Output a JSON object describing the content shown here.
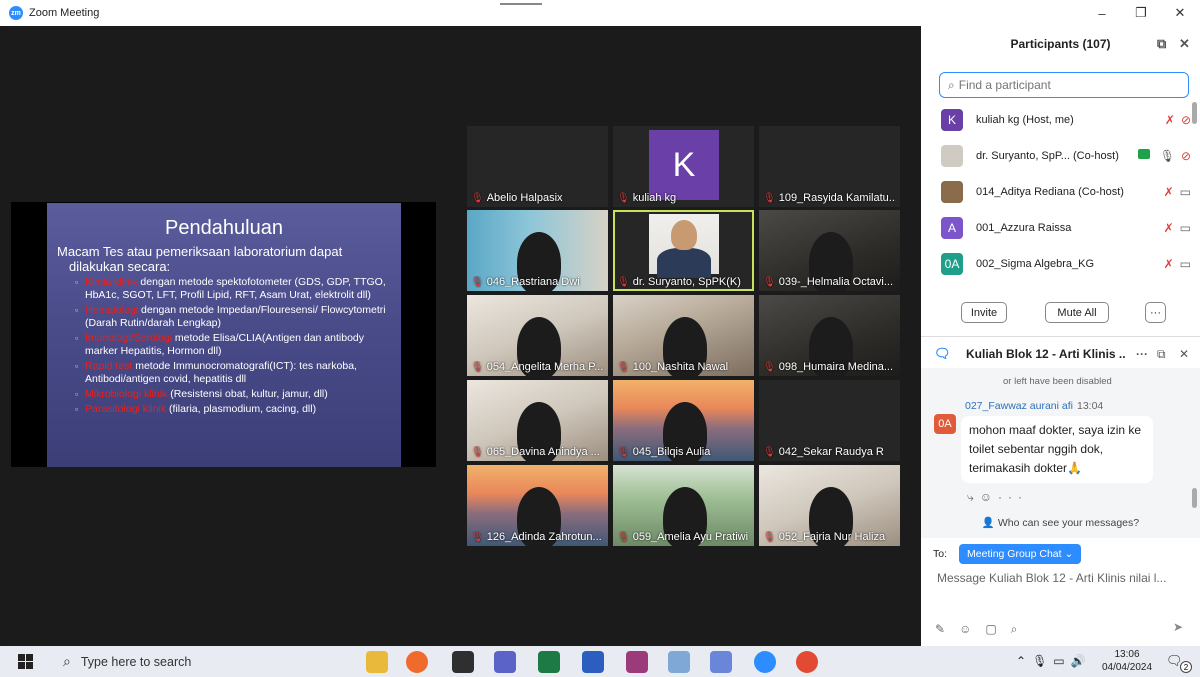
{
  "window": {
    "title": "Zoom Meeting",
    "minimize": "–",
    "restore": "❐",
    "close": "✕"
  },
  "slide": {
    "title": "Pendahuluan",
    "lead1": "Macam Tes atau pemeriksaan laboratorium dapat",
    "lead2": "dilakukan secara:",
    "items": [
      {
        "key": "Kimia klinik",
        "text": " dengan metode spektofotometer (GDS, GDP, TTGO, HbA1c,   SGOT, LFT, Profil Lipid, RFT, Asam Urat, elektrolit dll)"
      },
      {
        "key": "Hematologi",
        "text": " dengan metode Impedan/Flouresensi/ Flowcytometri (Darah Rutin/darah Lengkap)"
      },
      {
        "key": "Imunologi/Serologi",
        "text": " metode Elisa/CLIA(Antigen dan antibody marker Hepatitis, Hormon dll)"
      },
      {
        "key": "Rapid test",
        "text": " metode Immunocromatografi(ICT): tes narkoba, Antibodi/antigen covid, hepatitis dll"
      },
      {
        "key": "Mikrobiologi klinik",
        "text": " (Resistensi obat, kultur, jamur, dll)"
      },
      {
        "key": "Parasitologi klinik",
        "text": " (filaria, plasmodium, cacing, dll)"
      }
    ]
  },
  "gallery": [
    {
      "name": "Abelio Halpasix",
      "bg": "none"
    },
    {
      "name": "kuliah kg",
      "bg": "avatar",
      "initial": "K"
    },
    {
      "name": "109_Rasyida Kamilatu...",
      "bg": "none"
    },
    {
      "name": "046_Rastriana Dwi",
      "bg": "window"
    },
    {
      "name": "dr. Suryanto, SpPK(K)",
      "bg": "speaker",
      "active": true
    },
    {
      "name": "039-_Helmalia Octavi...",
      "bg": "dark"
    },
    {
      "name": "054_Angelita Merha P...",
      "bg": "light"
    },
    {
      "name": "100_Nashita Nawal",
      "bg": "room"
    },
    {
      "name": "098_Humaira Medina...",
      "bg": "dark"
    },
    {
      "name": "065_Davina Anindya ...",
      "bg": "light"
    },
    {
      "name": "045_Bilqis Aulia",
      "bg": "bridge"
    },
    {
      "name": "042_Sekar Raudya R",
      "bg": "none"
    },
    {
      "name": "126_Adinda Zahrotun...",
      "bg": "bridge"
    },
    {
      "name": "059_Amelia Ayu Pratiwi",
      "bg": "palm"
    },
    {
      "name": "052_Fajria Nur Haliza",
      "bg": "light"
    }
  ],
  "participants": {
    "header": "Participants (107)",
    "search_placeholder": "Find a participant",
    "list": [
      {
        "initial": "K",
        "color": "#6b3fa8",
        "name": "kuliah kg (Host, me)"
      },
      {
        "initial": "",
        "color": "#cfcac2",
        "name": "dr. Suryanto, SpP... (Co-host)"
      },
      {
        "initial": "",
        "color": "#8a6b4a",
        "name": "014_Aditya Rediana (Co-host)"
      },
      {
        "initial": "A",
        "color": "#7b55c9",
        "name": "001_Azzura Raissa"
      },
      {
        "initial": "0A",
        "color": "#1f9e8a",
        "name": "002_Sigma Algebra_KG"
      }
    ],
    "invite": "Invite",
    "mute_all": "Mute All",
    "more": "···"
  },
  "chat": {
    "title": "Kuliah Blok 12 - Arti Klinis ...",
    "disabled_note": "or left have been disabled",
    "sender": "027_Fawwaz aurani afi",
    "time": "13:04",
    "avatar": "0A",
    "message": "mohon maaf dokter, saya izin ke toilet sebentar nggih dok, terimakasih dokter🙏",
    "who_can_see": "Who can see your messages?",
    "to_label": "To:",
    "to_value": "Meeting Group Chat",
    "input_placeholder": "Message Kuliah Blok 12 - Arti Klinis nilai l..."
  },
  "taskbar": {
    "search_placeholder": "Type here to search",
    "time": "13:06",
    "date": "04/04/2024",
    "notif": "2"
  }
}
